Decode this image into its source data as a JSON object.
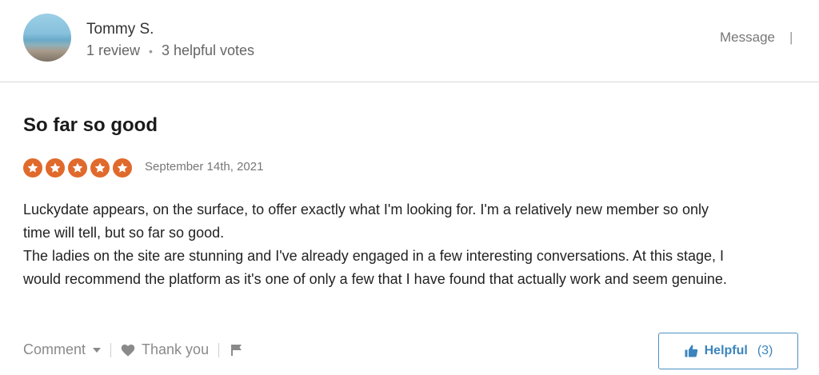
{
  "reviewer": {
    "name": "Tommy S.",
    "reviews": "1 review",
    "separator": "•",
    "helpful_votes": "3 helpful votes",
    "message_label": "Message",
    "header_separator": "|"
  },
  "review": {
    "title": "So far so good",
    "rating": 5,
    "max_rating": 5,
    "star_color": "#e06a2c",
    "date": "September 14th, 2021",
    "lines": [
      "Luckydate appears, on the surface, to offer exactly what I'm looking for. I'm a relatively new member so only",
      "time will tell, but so far so good.",
      "The ladies on the site are stunning and I've already engaged in a few interesting conversations. At this stage, I",
      "would recommend the platform as it's one of only a few that I have found that actually work and seem genuine."
    ]
  },
  "actions": {
    "comment_label": "Comment",
    "thank_you_label": "Thank you",
    "helpful_label": "Helpful",
    "helpful_count": "(3)",
    "accent_color": "#3b84bd"
  }
}
